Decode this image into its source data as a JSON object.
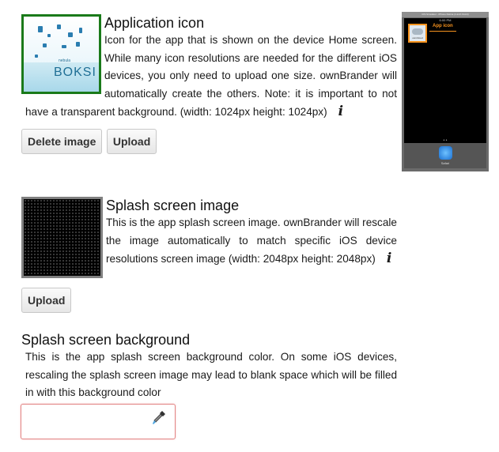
{
  "app_icon": {
    "title": "Application icon",
    "description": "Icon for the app that is shown on the device Home screen. While many icon resolutions are needed for the different iOS devices, you only need to upload one size. ownBrander will automatically create the others. Note: it is important to not have a transparent background. (width: 1024px height: 1024px)",
    "thumb_word": "BOKSI",
    "thumb_small": "nebula",
    "delete_label": "Delete image",
    "upload_label": "Upload",
    "info_icon": "info-icon"
  },
  "preview": {
    "titlebar": "iOS Simulator - iPhone Retina (4-inch 64-bit)",
    "time": "6:00 PM",
    "app_label": "App icon",
    "icon_caption": "ownCloud",
    "page_dots": "• •",
    "dock_app": "Safari"
  },
  "splash_image": {
    "title": "Splash screen image",
    "description": "This is the app splash screen image. ownBrander will rescale the image automatically to match specific iOS device resolutions screen image (width: 2048px height: 2048px)",
    "upload_label": "Upload",
    "info_icon": "info-icon"
  },
  "splash_bg": {
    "title": "Splash screen background",
    "description": "This is the app splash screen background color. On some iOS devices, rescaling the splash screen image may lead to blank space which will be filled in with this background color",
    "color_value": "",
    "picker_icon": "eyedropper-icon"
  },
  "colors": {
    "icon_border": "#1a7a1a",
    "input_border": "#e38686",
    "accent_orange": "#f7931e"
  }
}
